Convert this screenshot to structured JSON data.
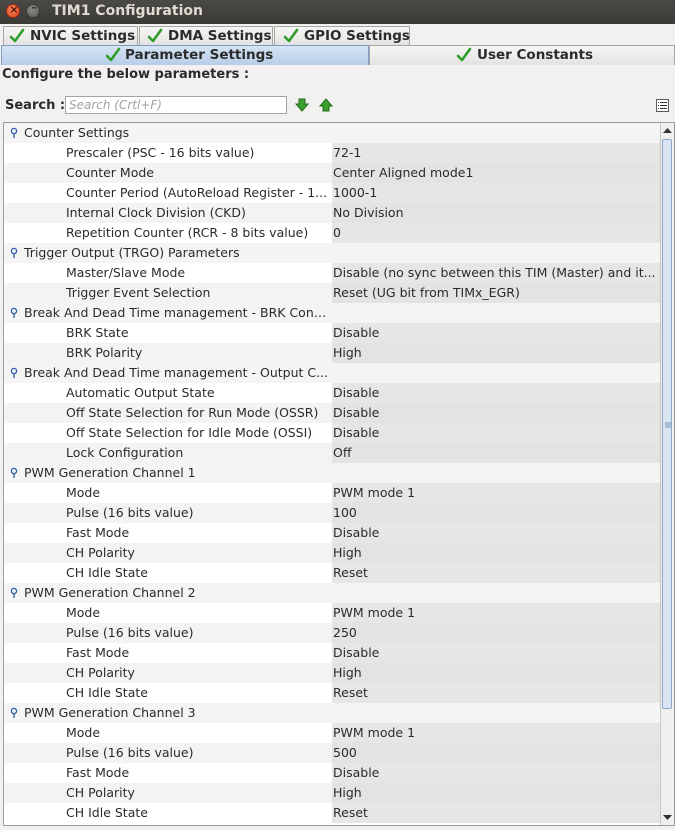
{
  "window": {
    "title": "TIM1 Configuration"
  },
  "tabs_top": [
    {
      "label": "NVIC Settings"
    },
    {
      "label": "DMA Settings"
    },
    {
      "label": "GPIO Settings"
    }
  ],
  "tabs_bottom": [
    {
      "label": "Parameter Settings",
      "active": true
    },
    {
      "label": "User Constants",
      "active": false
    }
  ],
  "configure_label": "Configure the below parameters :",
  "search": {
    "label": "Search :",
    "placeholder": "Search (Crtl+F)",
    "value": ""
  },
  "groups": [
    {
      "name": "Counter Settings",
      "params": [
        {
          "name": "Prescaler (PSC - 16 bits value)",
          "value": "72-1"
        },
        {
          "name": "Counter Mode",
          "value": "Center Aligned mode1"
        },
        {
          "name": "Counter Period (AutoReload Register - 1...",
          "value": "1000-1"
        },
        {
          "name": "Internal Clock Division (CKD)",
          "value": "No Division"
        },
        {
          "name": "Repetition Counter (RCR - 8 bits value)",
          "value": "0"
        }
      ]
    },
    {
      "name": "Trigger Output (TRGO) Parameters",
      "params": [
        {
          "name": "Master/Slave Mode",
          "value": "Disable (no sync between this TIM (Master) and it..."
        },
        {
          "name": "Trigger Event Selection",
          "value": "Reset (UG bit from TIMx_EGR)"
        }
      ]
    },
    {
      "name": "Break And Dead Time management - BRK Confi...",
      "params": [
        {
          "name": "BRK State",
          "value": "Disable"
        },
        {
          "name": "BRK Polarity",
          "value": "High"
        }
      ]
    },
    {
      "name": "Break And Dead Time management - Output C...",
      "params": [
        {
          "name": "Automatic Output State",
          "value": "Disable"
        },
        {
          "name": "Off State Selection for Run Mode (OSSR)",
          "value": "Disable"
        },
        {
          "name": "Off State Selection for Idle Mode (OSSI)",
          "value": "Disable"
        },
        {
          "name": "Lock Configuration",
          "value": "Off"
        }
      ]
    },
    {
      "name": "PWM Generation Channel 1",
      "params": [
        {
          "name": "Mode",
          "value": "PWM mode 1"
        },
        {
          "name": "Pulse (16 bits value)",
          "value": "100"
        },
        {
          "name": "Fast Mode",
          "value": "Disable"
        },
        {
          "name": "CH Polarity",
          "value": "High"
        },
        {
          "name": "CH Idle State",
          "value": "Reset"
        }
      ]
    },
    {
      "name": "PWM Generation Channel 2",
      "params": [
        {
          "name": "Mode",
          "value": "PWM mode 1"
        },
        {
          "name": "Pulse (16 bits value)",
          "value": "250"
        },
        {
          "name": "Fast Mode",
          "value": "Disable"
        },
        {
          "name": "CH Polarity",
          "value": "High"
        },
        {
          "name": "CH Idle State",
          "value": "Reset"
        }
      ]
    },
    {
      "name": "PWM Generation Channel 3",
      "params": [
        {
          "name": "Mode",
          "value": "PWM mode 1"
        },
        {
          "name": "Pulse (16 bits value)",
          "value": "500"
        },
        {
          "name": "Fast Mode",
          "value": "Disable"
        },
        {
          "name": "CH Polarity",
          "value": "High"
        },
        {
          "name": "CH Idle State",
          "value": "Reset"
        }
      ]
    }
  ],
  "colors": {
    "accent_tab": "#b7cde8",
    "check_green": "#2f9d2a",
    "value_bg": "#e6e6e6"
  }
}
